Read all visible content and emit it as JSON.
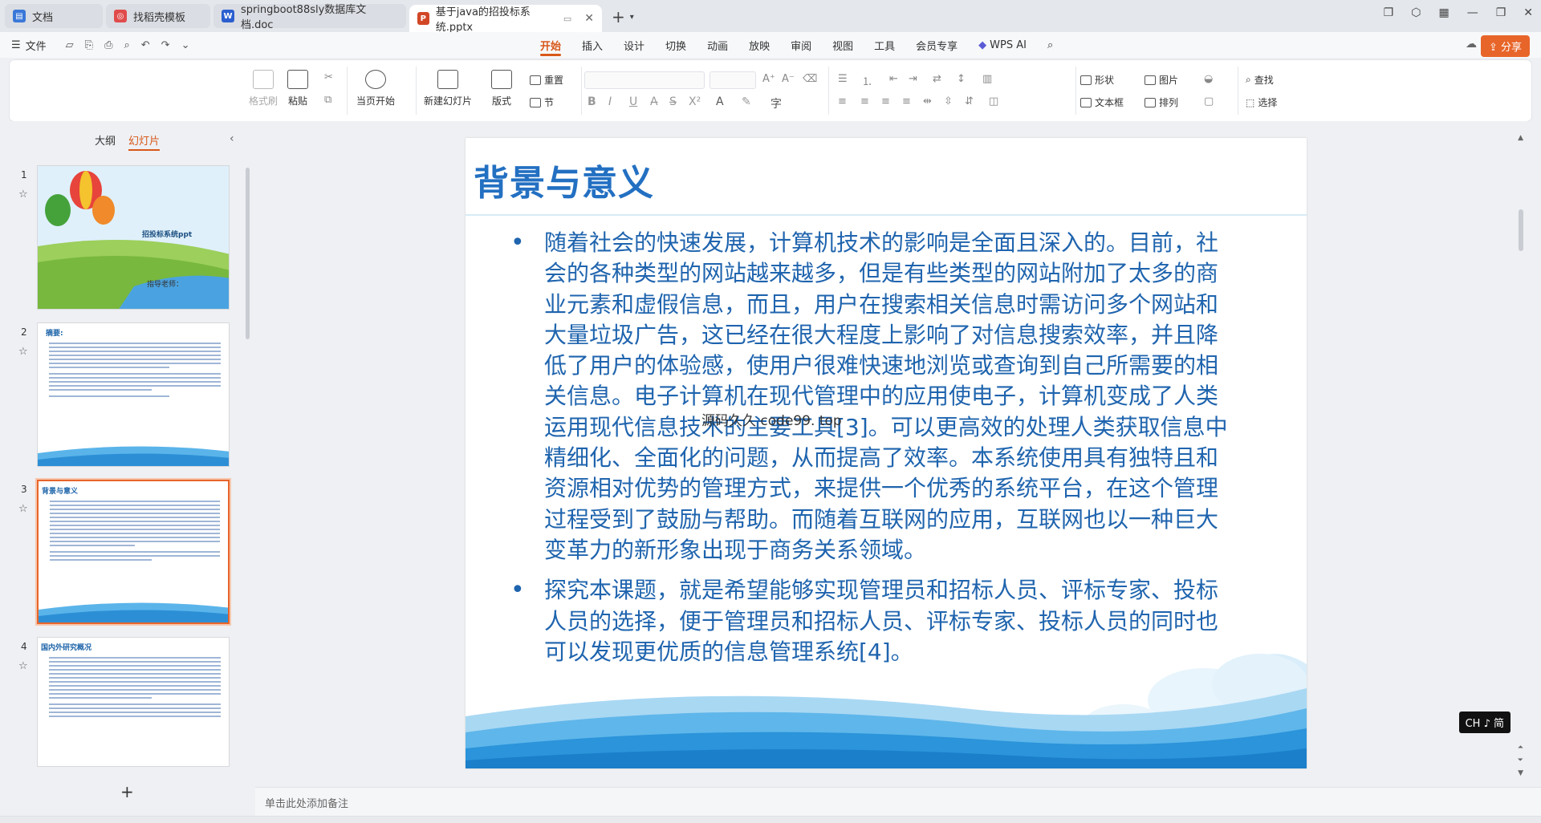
{
  "tabs": [
    {
      "label": "文档",
      "icon": "docs-icon",
      "color": "#3a78d8",
      "active": false
    },
    {
      "label": "找稻壳模板",
      "icon": "docer-icon",
      "color": "#e04c4c",
      "active": false
    },
    {
      "label": "springboot88sly数据库文档.doc",
      "icon": "word-icon",
      "color": "#2b5fd0",
      "active": false
    },
    {
      "label": "基于java的招投标系统.pptx",
      "icon": "ppt-icon",
      "color": "#d24726",
      "active": true
    }
  ],
  "menubar": {
    "file_label": "文件",
    "tabs": [
      "开始",
      "插入",
      "设计",
      "切换",
      "动画",
      "放映",
      "审阅",
      "视图",
      "工具",
      "会员专享"
    ],
    "active_tab": "开始",
    "wps_ai": "WPS AI",
    "share": "分享"
  },
  "ribbon": {
    "format_painter": "格式刷",
    "paste": "粘贴",
    "start_show": "当页开始",
    "new_slide": "新建幻灯片",
    "layout": "版式",
    "reset": "重置",
    "section": "节",
    "shape": "形状",
    "picture": "图片",
    "textbox": "文本框",
    "arrange": "排列",
    "find": "查找",
    "select": "选择"
  },
  "left_panel": {
    "tab_outline": "大纲",
    "tab_slides": "幻灯片",
    "active_tab": "幻灯片",
    "thumbnails": [
      {
        "num": "1",
        "title": "招投标系统ppt",
        "subtitle": "指导老师："
      },
      {
        "num": "2",
        "title": "摘要:"
      },
      {
        "num": "3",
        "title": "背景与意义"
      },
      {
        "num": "4",
        "title": "国内外研究概况"
      }
    ],
    "selected": "3"
  },
  "slide": {
    "title": "背景与意义",
    "bullets": [
      "随着社会的快速发展，计算机技术的影响是全面且深入的。目前，社会的各种类型的网站越来越多，但是有些类型的网站附加了太多的商业元素和虚假信息，而且，用户在搜索相关信息时需访问多个网站和大量垃圾广告，这已经在很大程度上影响了对信息搜索效率，并且降低了用户的体验感，使用户很难快速地浏览或查询到自己所需要的相关信息。电子计算机在现代管理中的应用使电子，计算机变成了人类运用现代信息技术的主要工具[3]。可以更高效的处理人类获取信息中精细化、全面化的问题，从而提高了效率。本系统使用具有独特且和资源相对优势的管理方式，来提供一个优秀的系统平台，在这个管理过程受到了鼓励与帮助。而随着互联网的应用，互联网也以一种巨大变革力的新形象出现于商务关系领域。",
      "探究本课题，就是希望能够实现管理员和招标人员、评标专家、投标人员的选择，便于管理员和招标人员、评标专家、投标人员的同时也可以发现更优质的信息管理系统[4]。"
    ],
    "watermark": "源码久久 code99. top"
  },
  "notes_placeholder": "单击此处添加备注",
  "ime_indicator": "CH ♪ 简",
  "colors": {
    "accent": "#d8581a",
    "title_blue": "#2370c2",
    "body_blue": "#1f64ae"
  }
}
